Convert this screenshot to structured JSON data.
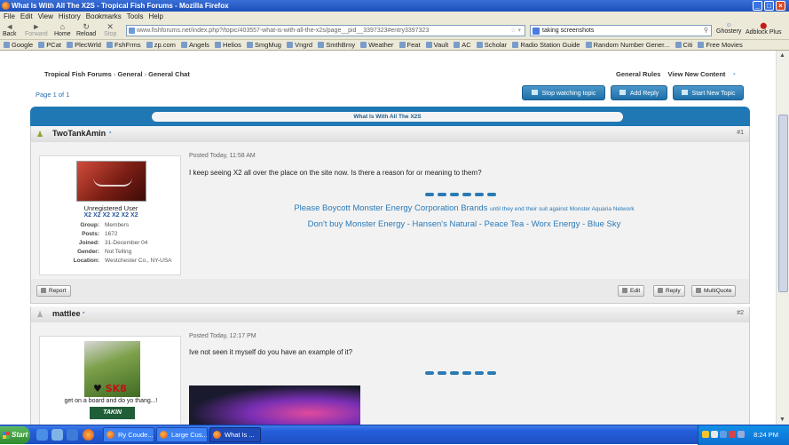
{
  "browser": {
    "window_title": "What Is With All The X2S - Tropical Fish Forums - Mozilla Firefox",
    "menu": [
      "File",
      "Edit",
      "View",
      "History",
      "Bookmarks",
      "Tools",
      "Help"
    ],
    "nav": {
      "back": "Back",
      "forward": "Forward",
      "home": "Home",
      "reload": "Reload",
      "stop": "Stop"
    },
    "url": "www.fishforums.net/index.php?/topic/403557-what-is-with-all-the-x2s/page__pid__3397323#entry3397323",
    "search_value": "taking screenshots",
    "addons": {
      "ghostery": "Ghostery",
      "adblock": "Adblock Plus"
    },
    "bookmarks": [
      "Google",
      "PCat",
      "PlecWrld",
      "FshFrms",
      "zp.com",
      "Angels",
      "Helios",
      "SmgMug",
      "Vngrd",
      "SmthBrny",
      "Weather",
      "Feat",
      "Vault",
      "AC",
      "Scholar",
      "Radio Station Guide",
      "Random Number Gener...",
      "Citi",
      "Free Movies"
    ]
  },
  "forum": {
    "breadcrumb": [
      "Tropical Fish Forums",
      "General",
      "General Chat"
    ],
    "top_links": [
      "General Rules",
      "View New Content"
    ],
    "page_label": "Page 1 of 1",
    "buttons": {
      "stop_watching": "Stop watching topic",
      "add_reply": "Add Reply",
      "new_topic": "Start New Topic"
    },
    "topic_title": "What Is With All The X2S"
  },
  "posts": [
    {
      "author": "TwoTankAmin",
      "number": "#1",
      "role": "Unregistered User",
      "badges": "X2 X2 X2 X2 X2 X2",
      "fields": [
        {
          "k": "Group:",
          "v": "Members"
        },
        {
          "k": "Posts:",
          "v": "1672"
        },
        {
          "k": "Joined:",
          "v": "31-December 04"
        },
        {
          "k": "Gender:",
          "v": "Not Telling"
        },
        {
          "k": "Location:",
          "v": "Westchester Co., NY-USA"
        }
      ],
      "date": "Posted Today, 11:58 AM",
      "text": "I keep seeing X2 all over the place on the site now. Is there a reason for or meaning to them?",
      "sig_line1": "Please Boycott Monster Energy Corporation Brands",
      "sig_line1_small": "until they end their suit against Monster Aquaria Network",
      "sig_line2": "Don't buy Monster Energy - Hansen's Natural - Peace Tea - Worx Energy - Blue Sky",
      "actions": {
        "report": "Report",
        "edit": "Edit",
        "reply": "Reply",
        "multiquote": "MultiQuote"
      }
    },
    {
      "author": "mattlee",
      "number": "#2",
      "avatar_text": "SK8",
      "tagline": "get on a board and do yo thang...!",
      "logo_text": "TAKIN",
      "date": "Posted Today, 12:17 PM",
      "text": "Ive not seen it myself do you have an example of it?"
    }
  ],
  "taskbar": {
    "start": "Start",
    "tasks": [
      "Ry Coude...",
      "Large Cus...",
      "What Is ..."
    ],
    "clock": "8:24 PM"
  }
}
